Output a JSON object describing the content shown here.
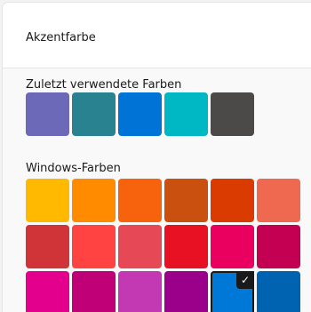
{
  "header": {
    "title": "Akzentfarbe"
  },
  "recent": {
    "label": "Zuletzt verwendete Farben",
    "colors": [
      "#6b69b8",
      "#288290",
      "#0074d6",
      "#00b7c4",
      "#4c4a48"
    ]
  },
  "windows": {
    "label": "Windows-Farben",
    "colors": [
      "#ffb900",
      "#ff8c00",
      "#f7630c",
      "#ca5010",
      "#da3b01",
      "#ef6950",
      "#d13438",
      "#ff4343",
      "#e74856",
      "#e81123",
      "#ea005e",
      "#c30052",
      "#e3008c",
      "#bf0077",
      "#c239b3",
      "#9a0089",
      "#0078d7",
      "#0063b1"
    ],
    "selected_index": 16,
    "check_glyph": "✓"
  }
}
